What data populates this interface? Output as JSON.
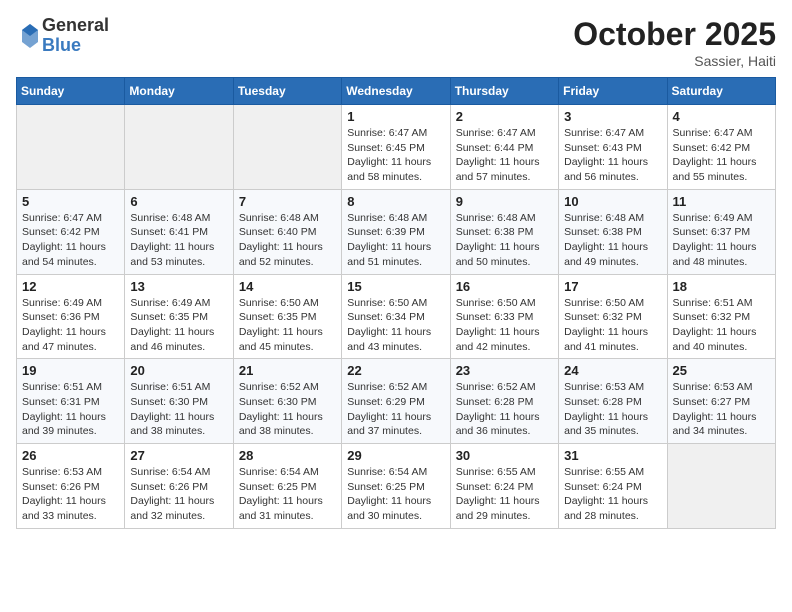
{
  "header": {
    "logo": {
      "general": "General",
      "blue": "Blue"
    },
    "title": "October 2025",
    "subtitle": "Sassier, Haiti"
  },
  "calendar": {
    "days_of_week": [
      "Sunday",
      "Monday",
      "Tuesday",
      "Wednesday",
      "Thursday",
      "Friday",
      "Saturday"
    ],
    "weeks": [
      [
        {
          "day": "",
          "sunrise": "",
          "sunset": "",
          "daylight": "",
          "empty": true
        },
        {
          "day": "",
          "sunrise": "",
          "sunset": "",
          "daylight": "",
          "empty": true
        },
        {
          "day": "",
          "sunrise": "",
          "sunset": "",
          "daylight": "",
          "empty": true
        },
        {
          "day": "1",
          "sunrise": "Sunrise: 6:47 AM",
          "sunset": "Sunset: 6:45 PM",
          "daylight": "Daylight: 11 hours and 58 minutes."
        },
        {
          "day": "2",
          "sunrise": "Sunrise: 6:47 AM",
          "sunset": "Sunset: 6:44 PM",
          "daylight": "Daylight: 11 hours and 57 minutes."
        },
        {
          "day": "3",
          "sunrise": "Sunrise: 6:47 AM",
          "sunset": "Sunset: 6:43 PM",
          "daylight": "Daylight: 11 hours and 56 minutes."
        },
        {
          "day": "4",
          "sunrise": "Sunrise: 6:47 AM",
          "sunset": "Sunset: 6:42 PM",
          "daylight": "Daylight: 11 hours and 55 minutes."
        }
      ],
      [
        {
          "day": "5",
          "sunrise": "Sunrise: 6:47 AM",
          "sunset": "Sunset: 6:42 PM",
          "daylight": "Daylight: 11 hours and 54 minutes."
        },
        {
          "day": "6",
          "sunrise": "Sunrise: 6:48 AM",
          "sunset": "Sunset: 6:41 PM",
          "daylight": "Daylight: 11 hours and 53 minutes."
        },
        {
          "day": "7",
          "sunrise": "Sunrise: 6:48 AM",
          "sunset": "Sunset: 6:40 PM",
          "daylight": "Daylight: 11 hours and 52 minutes."
        },
        {
          "day": "8",
          "sunrise": "Sunrise: 6:48 AM",
          "sunset": "Sunset: 6:39 PM",
          "daylight": "Daylight: 11 hours and 51 minutes."
        },
        {
          "day": "9",
          "sunrise": "Sunrise: 6:48 AM",
          "sunset": "Sunset: 6:38 PM",
          "daylight": "Daylight: 11 hours and 50 minutes."
        },
        {
          "day": "10",
          "sunrise": "Sunrise: 6:48 AM",
          "sunset": "Sunset: 6:38 PM",
          "daylight": "Daylight: 11 hours and 49 minutes."
        },
        {
          "day": "11",
          "sunrise": "Sunrise: 6:49 AM",
          "sunset": "Sunset: 6:37 PM",
          "daylight": "Daylight: 11 hours and 48 minutes."
        }
      ],
      [
        {
          "day": "12",
          "sunrise": "Sunrise: 6:49 AM",
          "sunset": "Sunset: 6:36 PM",
          "daylight": "Daylight: 11 hours and 47 minutes."
        },
        {
          "day": "13",
          "sunrise": "Sunrise: 6:49 AM",
          "sunset": "Sunset: 6:35 PM",
          "daylight": "Daylight: 11 hours and 46 minutes."
        },
        {
          "day": "14",
          "sunrise": "Sunrise: 6:50 AM",
          "sunset": "Sunset: 6:35 PM",
          "daylight": "Daylight: 11 hours and 45 minutes."
        },
        {
          "day": "15",
          "sunrise": "Sunrise: 6:50 AM",
          "sunset": "Sunset: 6:34 PM",
          "daylight": "Daylight: 11 hours and 43 minutes."
        },
        {
          "day": "16",
          "sunrise": "Sunrise: 6:50 AM",
          "sunset": "Sunset: 6:33 PM",
          "daylight": "Daylight: 11 hours and 42 minutes."
        },
        {
          "day": "17",
          "sunrise": "Sunrise: 6:50 AM",
          "sunset": "Sunset: 6:32 PM",
          "daylight": "Daylight: 11 hours and 41 minutes."
        },
        {
          "day": "18",
          "sunrise": "Sunrise: 6:51 AM",
          "sunset": "Sunset: 6:32 PM",
          "daylight": "Daylight: 11 hours and 40 minutes."
        }
      ],
      [
        {
          "day": "19",
          "sunrise": "Sunrise: 6:51 AM",
          "sunset": "Sunset: 6:31 PM",
          "daylight": "Daylight: 11 hours and 39 minutes."
        },
        {
          "day": "20",
          "sunrise": "Sunrise: 6:51 AM",
          "sunset": "Sunset: 6:30 PM",
          "daylight": "Daylight: 11 hours and 38 minutes."
        },
        {
          "day": "21",
          "sunrise": "Sunrise: 6:52 AM",
          "sunset": "Sunset: 6:30 PM",
          "daylight": "Daylight: 11 hours and 38 minutes."
        },
        {
          "day": "22",
          "sunrise": "Sunrise: 6:52 AM",
          "sunset": "Sunset: 6:29 PM",
          "daylight": "Daylight: 11 hours and 37 minutes."
        },
        {
          "day": "23",
          "sunrise": "Sunrise: 6:52 AM",
          "sunset": "Sunset: 6:28 PM",
          "daylight": "Daylight: 11 hours and 36 minutes."
        },
        {
          "day": "24",
          "sunrise": "Sunrise: 6:53 AM",
          "sunset": "Sunset: 6:28 PM",
          "daylight": "Daylight: 11 hours and 35 minutes."
        },
        {
          "day": "25",
          "sunrise": "Sunrise: 6:53 AM",
          "sunset": "Sunset: 6:27 PM",
          "daylight": "Daylight: 11 hours and 34 minutes."
        }
      ],
      [
        {
          "day": "26",
          "sunrise": "Sunrise: 6:53 AM",
          "sunset": "Sunset: 6:26 PM",
          "daylight": "Daylight: 11 hours and 33 minutes."
        },
        {
          "day": "27",
          "sunrise": "Sunrise: 6:54 AM",
          "sunset": "Sunset: 6:26 PM",
          "daylight": "Daylight: 11 hours and 32 minutes."
        },
        {
          "day": "28",
          "sunrise": "Sunrise: 6:54 AM",
          "sunset": "Sunset: 6:25 PM",
          "daylight": "Daylight: 11 hours and 31 minutes."
        },
        {
          "day": "29",
          "sunrise": "Sunrise: 6:54 AM",
          "sunset": "Sunset: 6:25 PM",
          "daylight": "Daylight: 11 hours and 30 minutes."
        },
        {
          "day": "30",
          "sunrise": "Sunrise: 6:55 AM",
          "sunset": "Sunset: 6:24 PM",
          "daylight": "Daylight: 11 hours and 29 minutes."
        },
        {
          "day": "31",
          "sunrise": "Sunrise: 6:55 AM",
          "sunset": "Sunset: 6:24 PM",
          "daylight": "Daylight: 11 hours and 28 minutes."
        },
        {
          "day": "",
          "sunrise": "",
          "sunset": "",
          "daylight": "",
          "empty": true
        }
      ]
    ]
  }
}
